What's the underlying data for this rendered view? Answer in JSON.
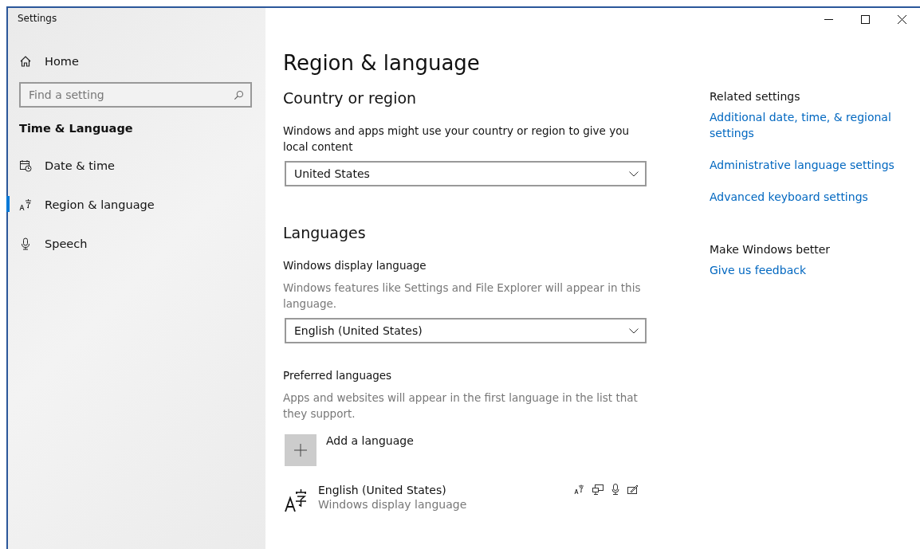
{
  "window": {
    "title": "Settings"
  },
  "sidebar": {
    "home": "Home",
    "search": {
      "placeholder": "Find a setting"
    },
    "section": "Time & Language",
    "items": [
      {
        "label": "Date & time",
        "selected": false
      },
      {
        "label": "Region & language",
        "selected": true
      },
      {
        "label": "Speech",
        "selected": false
      }
    ]
  },
  "page": {
    "title": "Region & language",
    "country": {
      "heading": "Country or region",
      "description": "Windows and apps might use your country or region to give you local content",
      "value": "United States"
    },
    "languages": {
      "heading": "Languages",
      "display_label": "Windows display language",
      "display_description": "Windows features like Settings and File Explorer will appear in this language.",
      "display_value": "English (United States)",
      "preferred_label": "Preferred languages",
      "preferred_description": "Apps and websites will appear in the first language in the list that they support.",
      "add": "Add a language",
      "list": [
        {
          "name": "English (United States)",
          "detail": "Windows display language"
        }
      ]
    }
  },
  "related": {
    "heading": "Related settings",
    "links": [
      "Additional date, time, & regional settings",
      "Administrative language settings",
      "Advanced keyboard settings"
    ],
    "better_heading": "Make Windows better",
    "feedback": "Give us feedback"
  }
}
